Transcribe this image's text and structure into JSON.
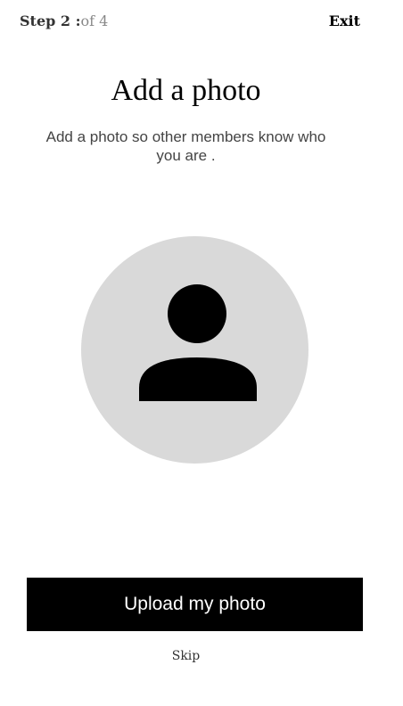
{
  "header": {
    "step_label": "Step 2 :",
    "step_total": "of 4",
    "exit_label": "Exit"
  },
  "main": {
    "title": "Add a photo",
    "subtitle": "Add a photo so other members know who you are .",
    "avatar_icon": "user-silhouette-icon"
  },
  "actions": {
    "upload_label": "Upload my photo",
    "skip_label": "Skip"
  },
  "colors": {
    "avatar_bg": "#d9d9d9",
    "primary_button": "#000000",
    "primary_button_text": "#ffffff"
  }
}
